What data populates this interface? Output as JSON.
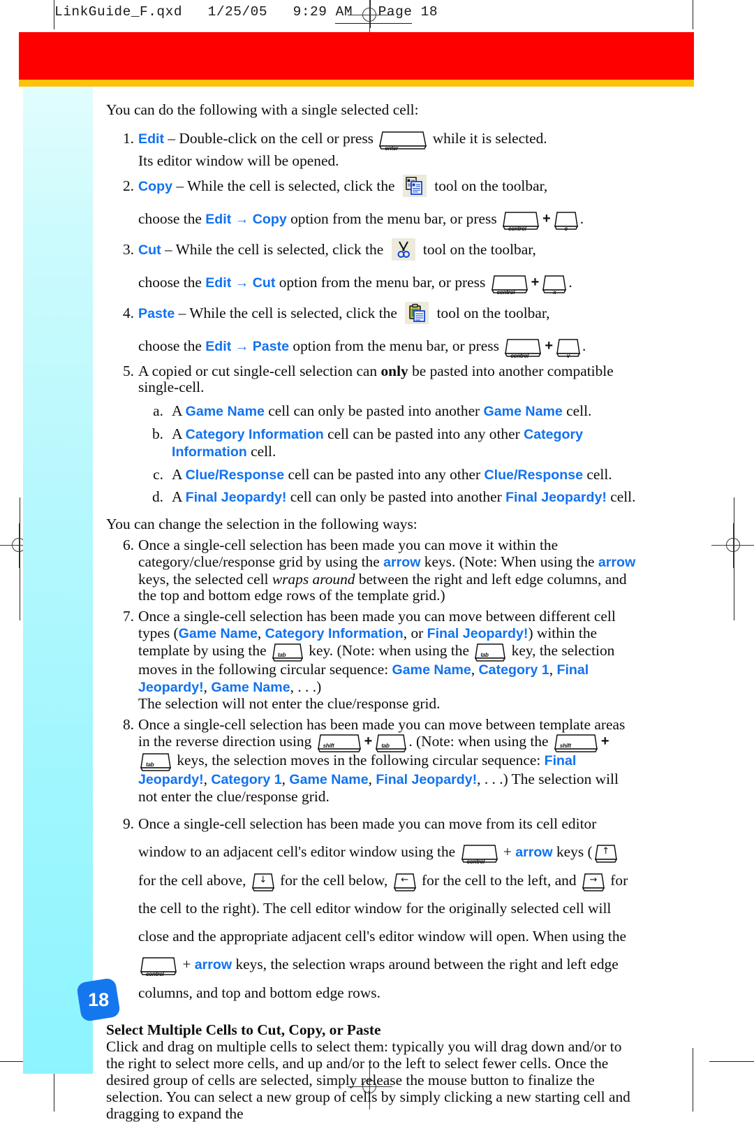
{
  "printer_slug": "LinkGuide_F.qxd   1/25/05   9:29 AM   Page 18",
  "page_number": "18",
  "colors": {
    "accent_blue": "#1172f0",
    "banner_red": "#fe0000",
    "banner_gold": "#fec20a",
    "sidebar_cyan": "#b6f8fd",
    "badge_blue": "#1577ee",
    "toolbar_icon_bg": "#eceadb"
  },
  "intro": {
    "single_cell": "You can do the following with a single selected cell:",
    "change_selection": "You can change the selection in the following ways:"
  },
  "keys": {
    "enter": "enter",
    "control": "control",
    "tab": "tab",
    "shift": "shift",
    "c": "c",
    "x": "x",
    "v": "v",
    "arrow_up": "↑",
    "arrow_down": "↓",
    "arrow_left": "←",
    "arrow_right": "→",
    "plus": "+"
  },
  "icons": {
    "copy": "copy-tool-icon",
    "cut": "cut-scissors-icon",
    "paste": "paste-clipboard-icon"
  },
  "items": {
    "n1": {
      "marker": "1.",
      "keyword": "Edit",
      "t1": " – Double-click on the cell or press ",
      "t2": " while it is selected.",
      "t3": "Its editor window will be opened."
    },
    "n2": {
      "marker": "2.",
      "keyword": "Copy",
      "t1": " – While the cell is selected, click the ",
      "t2": " tool on the toolbar,",
      "t3": "choose the ",
      "kw_edit": "Edit",
      "arrow": " → ",
      "kw_cmd": "Copy",
      "t4": " option from the menu bar, or press ",
      "t5": "."
    },
    "n3": {
      "marker": "3.",
      "keyword": "Cut",
      "t1": " – While the cell is selected, click the ",
      "t2": " tool on the toolbar,",
      "t3": "choose the ",
      "kw_edit": "Edit",
      "arrow": " → ",
      "kw_cmd": "Cut",
      "t4": " option from the menu bar, or press ",
      "t5": "."
    },
    "n4": {
      "marker": "4.",
      "keyword": "Paste",
      "t1": " – While the cell is selected, click the ",
      "t2": " tool on the toolbar,",
      "t3": "choose the ",
      "kw_edit": "Edit",
      "arrow": " → ",
      "kw_cmd": "Paste",
      "t4": " option from the menu bar, or press ",
      "t5": "."
    },
    "n5": {
      "marker": "5.",
      "t1": "A copied or cut single-cell selection can ",
      "bold": "only",
      "t2": " be pasted into another compatible single-cell.",
      "subs": [
        {
          "marker": "a.",
          "t1": "A ",
          "kw1": "Game Name",
          "t2": " cell can only be pasted into another ",
          "kw2": "Game Name",
          "t3": " cell."
        },
        {
          "marker": "b.",
          "t1": "A ",
          "kw1": "Category Information",
          "t2": " cell can be pasted into any other ",
          "kw2": "Category Information",
          "t3": " cell."
        },
        {
          "marker": "c.",
          "t1": "A ",
          "kw1": "Clue/Response",
          "t2": " cell can be pasted into any other ",
          "kw2": "Clue/Response",
          "t3": " cell."
        },
        {
          "marker": "d.",
          "t1": "A ",
          "kw1": "Final Jeopardy!",
          "t2": " cell can only be pasted into another ",
          "kw2": "Final Jeopardy!",
          "t3": " cell."
        }
      ]
    },
    "n6": {
      "marker": "6.",
      "t1": "Once a single-cell selection has been made you can move it within the category/clue/response grid by using the ",
      "kw1": "arrow",
      "t2": " keys. (Note: When using the ",
      "kw2": "arrow",
      "t3": " keys, the selected cell ",
      "it1": "wraps around",
      "t4": " between the right and left edge columns, and the top and bottom edge rows of the template grid.)"
    },
    "n7": {
      "marker": "7.",
      "t1": "Once a single-cell selection has been made you can move between different cell types (",
      "kw1": "Game Name",
      "t2": ", ",
      "kw2": "Category Information",
      "t3": ", or ",
      "kw3": "Final Jeopardy!",
      "t4": ") within the template by using the ",
      "t5": " key. (Note: when using the ",
      "t6": " key, the selection moves in the following circular sequence: ",
      "kw4": "Game Name",
      "t7": ", ",
      "kw5": "Category 1",
      "t8": ", ",
      "kw6": "Final Jeopardy!",
      "t9": ", ",
      "kw7": "Game Name",
      "t10": ", . . .)",
      "t11": "The selection will not enter the clue/response grid."
    },
    "n8": {
      "marker": "8.",
      "t1": "Once a single-cell selection has been made you can move between template areas in the reverse direction using ",
      "t2": ". (Note: when using the ",
      "t3": " keys, the selection moves in the following circular sequence: ",
      "kw1": "Final Jeopardy!",
      "t4": ", ",
      "kw2": "Category 1",
      "t5": ", ",
      "kw3": "Game Name",
      "t6": ", ",
      "kw4": "Final Jeopardy!",
      "t7": ", . . .) The selection will not enter the clue/response grid."
    },
    "n9": {
      "marker": "9.",
      "t1": "Once a single-cell selection has been made you can move from its cell editor window to an adjacent cell's editor window using the ",
      "t2": " + ",
      "kw1": "arrow",
      "t3": " keys (",
      "t4": " for the cell above, ",
      "t5": " for the cell below, ",
      "t6": " for the cell to the left, and ",
      "t7": " for the cell to the right). The cell editor window for the originally selected cell will close and the appropriate adjacent cell's editor window will open. When using the ",
      "t8": " + ",
      "kw2": "arrow",
      "t9": " keys, the selection wraps around between the right and left edge columns, and top and bottom edge rows."
    }
  },
  "section": {
    "heading": "Select Multiple Cells to Cut, Copy, or Paste",
    "body": "Click and drag on multiple cells to select them: typically you will drag down and/or to the right to select more cells, and up and/or to the left to select fewer cells. Once the desired group of cells are selected, simply release the mouse button to finalize the selection. You can select a new group of cells by simply clicking a new starting cell and dragging to expand the"
  }
}
